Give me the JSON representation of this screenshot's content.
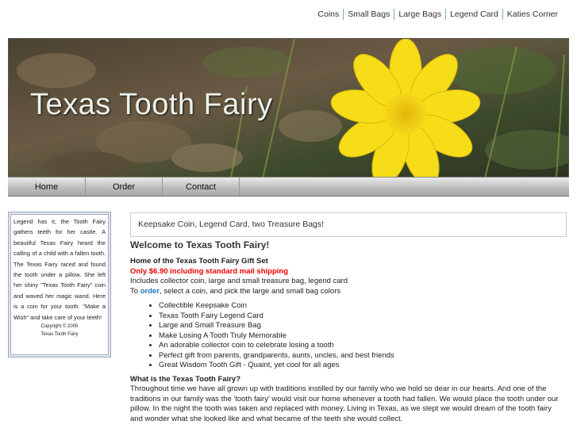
{
  "topnav": [
    "Coins",
    "Small Bags",
    "Large Bags",
    "Legend Card",
    "Katies Corner"
  ],
  "banner": {
    "title": "Texas Tooth Fairy"
  },
  "mainnav": [
    "Home",
    "Order",
    "Contact"
  ],
  "sidebar": {
    "text": "Legend has it, the Tooth Fairy gathers teeth for her castle. A beautiful Texas Fairy heard the calling of a child with a fallen tooth. The Texas Fairy raced and found the tooth under a pillow. She left her shiny \"Texas Tooth Fairy\" coin and waved her magic wand. Here is a coin for your tooth. \"Make a Wish\" and take care of your teeth!",
    "copyright": "Copyright © 2005",
    "copyright_name": "Texas Tooth Fairy"
  },
  "keepsake": "Keepsake Coin, Legend Card, two Treasure Bags!",
  "main": {
    "welcome": "Welcome to Texas Tooth Fairy!",
    "home_of": "Home of the Texas Tooth Fairy Gift Set",
    "price": "Only $6.90 including standard mail shipping",
    "includes": "Includes collector coin, large and small treasure bag, legend card",
    "order_prefix": "To ",
    "order_link": "order",
    "order_suffix": ", select a coin, and pick the large and small bag colors",
    "bullets": [
      "Collectible Keepsake Coin",
      "Texas Tooth Fairy Legend Card",
      "Large and Small Treasure Bag",
      "Make Losing A Tooth Truly Memorable",
      "An adorable collector coin to celebrate losing a tooth",
      "Perfect gift from parents, grandparents, aunts, uncles, and best friends",
      "Great Wisdom Tooth Gift - Quaint, yet cool for all ages"
    ],
    "question": "What is the Texas Tooth Fairy?",
    "body": "Throughout time we have all grown up with traditions instilled by our family who we hold so dear in our hearts. And one of the traditions in our family was the 'tooth fairy' would visit our home whenever a tooth had fallen. We would place the tooth under our pillow. In the night the tooth was taken and replaced with money. Living in Texas, as we slept we would dream of the tooth fairy and wonder what she looked like and what became of the teeth she would collect."
  },
  "colors": {
    "accent": "#1a75b8",
    "price": "#ee0000",
    "flower": "#f6dd18"
  }
}
